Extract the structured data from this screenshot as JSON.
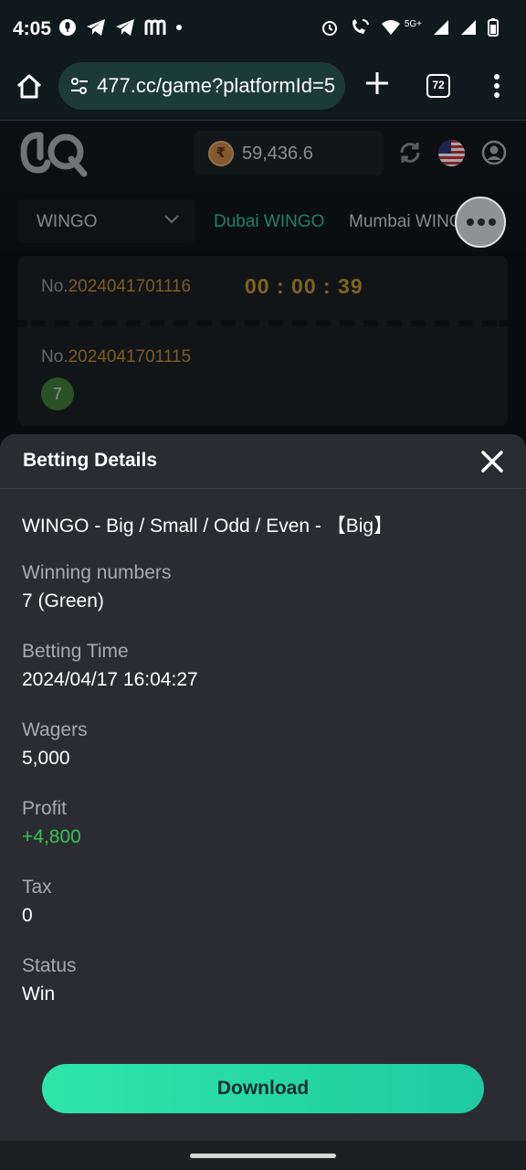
{
  "status_bar": {
    "time": "4:05",
    "network": "5G+"
  },
  "browser": {
    "url": "477.cc/game?platformId=5",
    "tab_count": "72"
  },
  "header": {
    "currency_symbol": "₹",
    "balance": "59,436.6"
  },
  "game_tabs": {
    "selected_game": "WINGO",
    "tabs": [
      "Dubai WINGO",
      "Mumbai WINGO"
    ]
  },
  "draw": {
    "current_prefix": "No.",
    "current_no": "2024041701116",
    "countdown": "00 : 00 : 39",
    "previous_prefix": "No.",
    "previous_no": "2024041701115",
    "previous_result": "7"
  },
  "betting_details": {
    "title": "Betting Details",
    "bet_type": "WINGO - Big / Small / Odd / Even - 【Big】",
    "fields": [
      {
        "label": "Winning numbers",
        "value": "7 (Green)"
      },
      {
        "label": "Betting Time",
        "value": "2024/04/17 16:04:27"
      },
      {
        "label": "Wagers",
        "value": "5,000"
      },
      {
        "label": "Profit",
        "value": "+4,800"
      },
      {
        "label": "Tax",
        "value": "0"
      },
      {
        "label": "Status",
        "value": "Win"
      }
    ],
    "download_label": "Download"
  },
  "colors": {
    "accent_green": "#2ec79b",
    "profit_green": "#38c15a",
    "gold": "#c08c3a"
  }
}
